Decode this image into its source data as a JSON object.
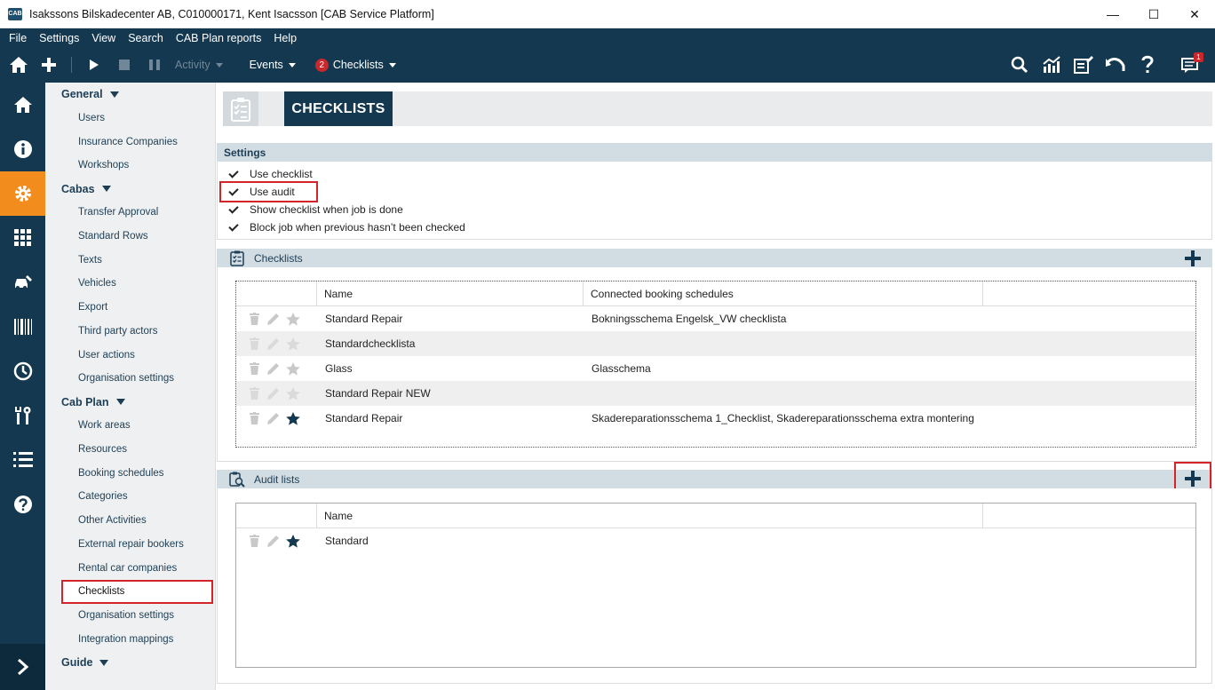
{
  "window": {
    "title": "Isakssons Bilskadecenter AB, C010000171, Kent Isacsson [CAB Service Platform]",
    "app_icon_text": "CAB",
    "minimize": "—",
    "maximize": "☐",
    "close": "✕"
  },
  "menubar": {
    "items": [
      "File",
      "Settings",
      "View",
      "Search",
      "CAB Plan reports",
      "Help"
    ]
  },
  "toolbar": {
    "activity_label": "Activity",
    "events_label": "Events",
    "checklists_label": "Checklists",
    "checklists_badge": "2",
    "messages_badge": "1"
  },
  "nav": {
    "groups": [
      {
        "label": "General",
        "items": [
          "Users",
          "Insurance Companies",
          "Workshops"
        ]
      },
      {
        "label": "Cabas",
        "items": [
          "Transfer Approval",
          "Standard Rows",
          "Texts",
          "Vehicles",
          "Export",
          "Third party actors",
          "User actions",
          "Organisation settings"
        ]
      },
      {
        "label": "Cab Plan",
        "items": [
          "Work areas",
          "Resources",
          "Booking schedules",
          "Categories",
          "Other Activities",
          "External repair bookers",
          "Rental car companies",
          "Checklists",
          "Organisation settings",
          "Integration mappings"
        ]
      },
      {
        "label": "Guide",
        "items": []
      }
    ],
    "selected": "Checklists"
  },
  "page": {
    "title": "CHECKLISTS"
  },
  "settings": {
    "header": "Settings",
    "options": [
      {
        "label": "Use checklist",
        "checked": true
      },
      {
        "label": "Use audit",
        "checked": true
      },
      {
        "label": "Show checklist when job is done",
        "checked": true
      },
      {
        "label": "Block job when previous hasn’t been checked",
        "checked": true
      }
    ]
  },
  "checklists": {
    "header": "Checklists",
    "columns": [
      "Name",
      "Connected booking schedules"
    ],
    "rows": [
      {
        "name": "Standard Repair",
        "schedules": "Bokningsschema Engelsk_VW checklista",
        "default": false
      },
      {
        "name": "Standardchecklista",
        "schedules": "",
        "default": false
      },
      {
        "name": "Glass",
        "schedules": "Glasschema",
        "default": false
      },
      {
        "name": "Standard Repair NEW",
        "schedules": "",
        "default": false
      },
      {
        "name": "Standard Repair",
        "schedules": "Skadereparationsschema 1_Checklist, Skadereparationsschema extra monteringstic",
        "default": true
      }
    ]
  },
  "audit_lists": {
    "header": "Audit lists",
    "columns": [
      "Name"
    ],
    "rows": [
      {
        "name": "Standard",
        "default": true
      }
    ]
  },
  "colors": {
    "navy": "#14384f",
    "accent_orange": "#f28c1c",
    "highlight_red": "#d3242a",
    "section_bar": "#d1dce3"
  }
}
